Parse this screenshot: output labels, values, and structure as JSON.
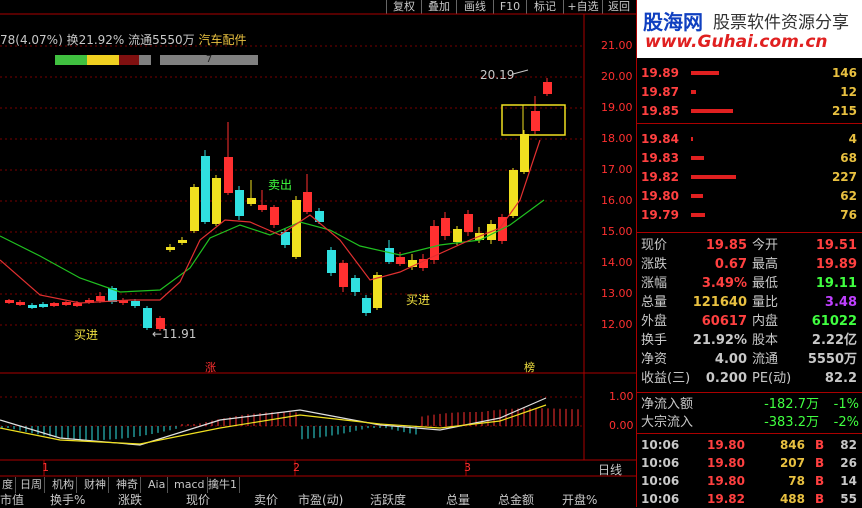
{
  "toolbar": {
    "buttons": [
      "复权",
      "叠加",
      "画线",
      "F10",
      "标记",
      "+自选",
      "返回"
    ]
  },
  "stock_info": {
    "text": "78(4.07%) 换21.92% 流通5550万",
    "industry": "汽车配件",
    "bar_label": "7"
  },
  "price_axis": [
    "21.00",
    "20.00",
    "19.00",
    "18.00",
    "17.00",
    "16.00",
    "15.00",
    "14.00",
    "13.00",
    "12.00"
  ],
  "macd_axis": [
    "1.00",
    "0.00"
  ],
  "annotations": {
    "high": "20.19",
    "low": "←11.91",
    "buy1": "买进",
    "sell": "卖出",
    "buy2": "买进",
    "zhang": "涨",
    "bang": "榜"
  },
  "time_axis": [
    "1",
    "2",
    "3"
  ],
  "period_label": "日线",
  "bottom_tabs": [
    "度",
    "日周",
    "机构",
    "财神",
    "神奇",
    "Aia",
    "macd",
    "擒牛1"
  ],
  "bottom_columns": [
    "市值",
    "换手%",
    "涨跌",
    "现价",
    "卖价",
    "市盈(动)",
    "活跃度",
    "总量",
    "总金额",
    "开盘%"
  ],
  "banner": {
    "logo": "股海网",
    "slogan": "股票软件资源分享",
    "url": "www.Guhai.com.cn"
  },
  "order_book": [
    {
      "price": "19.89",
      "vol": "146",
      "bar": 0.28
    },
    {
      "price": "19.87",
      "vol": "12",
      "bar": 0.05
    },
    {
      "price": "19.85",
      "vol": "215",
      "bar": 0.42
    },
    {
      "price": "19.84",
      "vol": "4",
      "bar": 0.02
    },
    {
      "price": "19.83",
      "vol": "68",
      "bar": 0.13
    },
    {
      "price": "19.82",
      "vol": "227",
      "bar": 0.45
    },
    {
      "price": "19.80",
      "vol": "62",
      "bar": 0.12
    },
    {
      "price": "19.79",
      "vol": "76",
      "bar": 0.14
    }
  ],
  "quote": [
    {
      "k1": "现价",
      "v1": "19.85",
      "c1": "#ff4040",
      "k2": "今开",
      "v2": "19.51",
      "c2": "#ff4040"
    },
    {
      "k1": "涨跌",
      "v1": "0.67",
      "c1": "#ff4040",
      "k2": "最高",
      "v2": "19.89",
      "c2": "#ff4040"
    },
    {
      "k1": "涨幅",
      "v1": "3.49%",
      "c1": "#ff4040",
      "k2": "最低",
      "v2": "19.11",
      "c2": "#40ff40"
    },
    {
      "k1": "总量",
      "v1": "121640",
      "c1": "#e8c040",
      "k2": "量比",
      "v2": "3.48",
      "c2": "#c040ff"
    },
    {
      "k1": "外盘",
      "v1": "60617",
      "c1": "#ff4040",
      "k2": "内盘",
      "v2": "61022",
      "c2": "#40ff40"
    },
    {
      "k1": "换手",
      "v1": "21.92%",
      "c1": "#c8c8c8",
      "k2": "股本",
      "v2": "2.22亿",
      "c2": "#c8c8c8"
    },
    {
      "k1": "净资",
      "v1": "4.00",
      "c1": "#c8c8c8",
      "k2": "流通",
      "v2": "5550万",
      "c2": "#c8c8c8"
    },
    {
      "k1": "收益(三)",
      "v1": "0.200",
      "c1": "#c8c8c8",
      "k2": "PE(动)",
      "v2": "82.2",
      "c2": "#c8c8c8"
    }
  ],
  "flow": [
    {
      "label": "净流入额",
      "value": "-182.7万",
      "pct": "-1%"
    },
    {
      "label": "大宗流入",
      "value": "-383.2万",
      "pct": "-2%"
    }
  ],
  "trades": [
    {
      "time": "10:06",
      "price": "19.80",
      "vol": "846",
      "side": "B",
      "n": "82"
    },
    {
      "time": "10:06",
      "price": "19.80",
      "vol": "207",
      "side": "B",
      "n": "26"
    },
    {
      "time": "10:06",
      "price": "19.80",
      "vol": "78",
      "side": "B",
      "n": "14"
    },
    {
      "time": "10:06",
      "price": "19.82",
      "vol": "488",
      "side": "B",
      "n": "55"
    }
  ]
}
